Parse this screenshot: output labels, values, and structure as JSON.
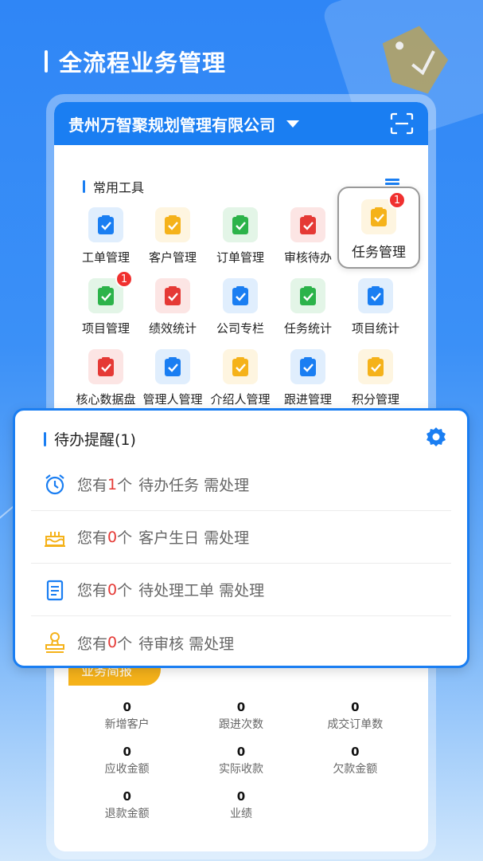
{
  "header": {
    "title": "全流程业务管理"
  },
  "company": {
    "name": "贵州万智聚规划管理有限公司"
  },
  "tools": {
    "section_title": "常用工具",
    "items": [
      {
        "label": "工单管理",
        "icon": "work-order-icon",
        "color": "#1a7ef2"
      },
      {
        "label": "客户管理",
        "icon": "customer-icon",
        "color": "#f5b21a"
      },
      {
        "label": "订单管理",
        "icon": "order-icon",
        "color": "#2cb34a"
      },
      {
        "label": "审核待办",
        "icon": "review-icon",
        "color": "#e53935"
      },
      {
        "label": "任务管理",
        "icon": "task-icon",
        "color": "#f5b21a",
        "badge": "1"
      },
      {
        "label": "项目管理",
        "icon": "project-icon",
        "color": "#2cb34a",
        "badge": "1"
      },
      {
        "label": "绩效统计",
        "icon": "performance-icon",
        "color": "#e53935"
      },
      {
        "label": "公司专栏",
        "icon": "column-icon",
        "color": "#1a7ef2"
      },
      {
        "label": "任务统计",
        "icon": "task-stats-icon",
        "color": "#2cb34a"
      },
      {
        "label": "项目统计",
        "icon": "project-stats-icon",
        "color": "#1a7ef2"
      },
      {
        "label": "核心数据盘",
        "icon": "database-icon",
        "color": "#e53935"
      },
      {
        "label": "管理人管理",
        "icon": "manager-icon",
        "color": "#1a7ef2"
      },
      {
        "label": "介绍人管理",
        "icon": "referrer-icon",
        "color": "#f5b21a"
      },
      {
        "label": "跟进管理",
        "icon": "followup-icon",
        "color": "#1a7ef2"
      },
      {
        "label": "积分管理",
        "icon": "points-icon",
        "color": "#f5b21a"
      }
    ]
  },
  "reminder": {
    "title": "待办提醒(1)",
    "items": [
      {
        "prefix": "您有",
        "count": "1",
        "suffix": "个",
        "text": "待办任务 需处理",
        "icon": "alarm-clock-icon"
      },
      {
        "prefix": "您有",
        "count": "0",
        "suffix": "个",
        "text": "客户生日 需处理",
        "icon": "birthday-cake-icon"
      },
      {
        "prefix": "您有",
        "count": "0",
        "suffix": "个",
        "text": "待处理工单 需处理",
        "icon": "clipboard-icon"
      },
      {
        "prefix": "您有",
        "count": "0",
        "suffix": "个",
        "text": "待审核 需处理",
        "icon": "stamp-icon"
      }
    ]
  },
  "stats": {
    "tab_label": "业务简报",
    "items": [
      {
        "value": "0",
        "label": "新增客户"
      },
      {
        "value": "0",
        "label": "跟进次数"
      },
      {
        "value": "0",
        "label": "成交订单数"
      },
      {
        "value": "0",
        "label": "应收金额"
      },
      {
        "value": "0",
        "label": "实际收款"
      },
      {
        "value": "0",
        "label": "欠款金额"
      },
      {
        "value": "0",
        "label": "退款金额"
      },
      {
        "value": "0",
        "label": "业绩"
      }
    ]
  }
}
